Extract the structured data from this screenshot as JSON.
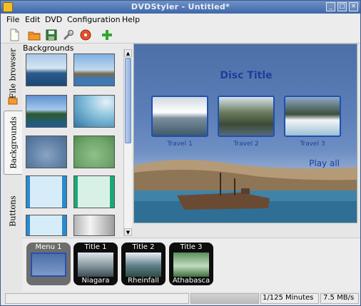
{
  "window": {
    "title": "DVDStyler - Untitled*"
  },
  "menubar": {
    "items": [
      "File",
      "Edit",
      "DVD",
      "Configuration",
      "Help"
    ]
  },
  "toolbar": {
    "buttons": [
      "new-file-icon",
      "open-folder-icon",
      "save-icon",
      "settings-wrench-icon",
      "burn-disc-icon",
      "add-file-icon"
    ]
  },
  "left_tabs": [
    {
      "label": "File browser"
    },
    {
      "label": "Backgrounds"
    },
    {
      "label": "Buttons"
    }
  ],
  "backgrounds_panel": {
    "title": "Backgrounds"
  },
  "menu_preview": {
    "title": "Disc Title",
    "titles": [
      "Travel 1",
      "Travel 2",
      "Travel 3"
    ],
    "play_all": "Play all"
  },
  "titleset": {
    "items": [
      {
        "top": "Menu 1",
        "bottom": ""
      },
      {
        "top": "Title 1",
        "bottom": "Niagara"
      },
      {
        "top": "Title 2",
        "bottom": "Rheinfall"
      },
      {
        "top": "Title 3",
        "bottom": "Athabasca"
      }
    ]
  },
  "status": {
    "usage": "1/125 Minutes",
    "rate": "7.5 MB/s"
  },
  "colors": {
    "title_bar": "#4f77b6",
    "preview_text": "#1c3f9a",
    "selection_border": "#1f4fb3"
  }
}
